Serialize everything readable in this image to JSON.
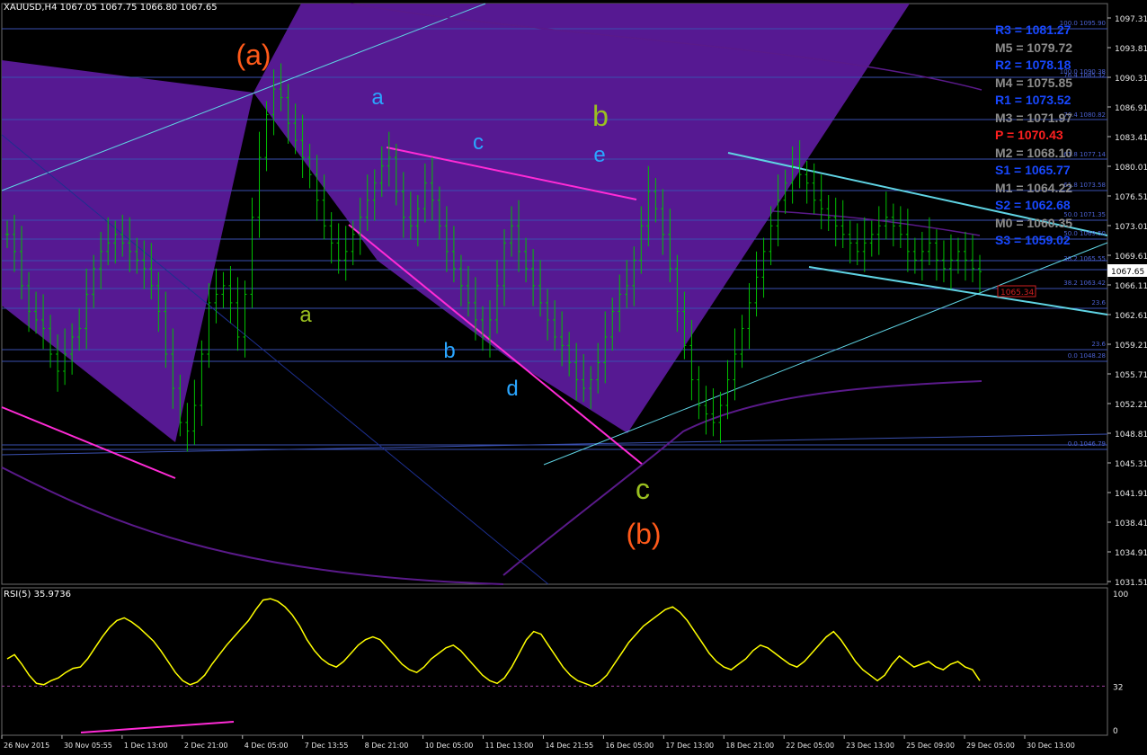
{
  "header": {
    "symbol": "XAUUSD,H4",
    "ohlc": "1067.05 1067.75 1066.80 1067.65",
    "rsi_label": "RSI(5) 35.9736"
  },
  "colors": {
    "background": "#000000",
    "candle": "#00c000",
    "wave_panel": "#5b1a9a",
    "magenta_line": "#ff2bd6",
    "cyan_line": "#5fd3e3",
    "fib_line": "#3a50b0",
    "ma_line": "#5a1a8a",
    "rsi_line": "#ffff00",
    "pivot_blue": "#1848ff",
    "pivot_gray": "#8c8c8c",
    "pivot_red": "#ff2020",
    "wave_orange": "#ff5a1a",
    "wave_green": "#9ac020",
    "wave_blue": "#2aa6ff"
  },
  "pivots": [
    {
      "label": "R3 = 1081.27",
      "color": "blue"
    },
    {
      "label": "M5 = 1079.72",
      "color": "gray"
    },
    {
      "label": "R2 = 1078.18",
      "color": "blue"
    },
    {
      "label": "M4 = 1075.85",
      "color": "gray"
    },
    {
      "label": "R1 = 1073.52",
      "color": "blue"
    },
    {
      "label": "M3 = 1071.97",
      "color": "gray"
    },
    {
      "label": "P  = 1070.43",
      "color": "red"
    },
    {
      "label": "M2 = 1068.10",
      "color": "gray"
    },
    {
      "label": "S1 = 1065.77",
      "color": "blue"
    },
    {
      "label": "M1 = 1064.22",
      "color": "gray"
    },
    {
      "label": "S2 = 1062.68",
      "color": "blue"
    },
    {
      "label": "M0 = 1060.35",
      "color": "gray"
    },
    {
      "label": "S3 = 1059.02",
      "color": "blue"
    }
  ],
  "wave_labels": [
    {
      "text": "(a)",
      "color": "orange"
    },
    {
      "text": "(b)",
      "color": "orange"
    },
    {
      "text": "a",
      "color": "blue"
    },
    {
      "text": "b",
      "color": "blue"
    },
    {
      "text": "c",
      "color": "blue"
    },
    {
      "text": "d",
      "color": "blue"
    },
    {
      "text": "e",
      "color": "blue"
    },
    {
      "text": "a",
      "color": "green"
    },
    {
      "text": "b",
      "color": "green"
    },
    {
      "text": "c",
      "color": "green"
    }
  ],
  "fib_labels": [
    "100.0 1095.90",
    "100.0 1090.38",
    "76.4 1085.32",
    "76.4 1080.82",
    "61.8 1077.14",
    "61.8 1073.58",
    "50.0 1071.35",
    "50.0 1069.50",
    "38.2 1065.55",
    "38.2 1063.42",
    "23.6",
    "23.6",
    "0.0 1048.28",
    "0.0 1046.79"
  ],
  "price_marker": "1065.34",
  "chart_data": {
    "type": "candlestick",
    "timeframe": "H4",
    "price_axis": {
      "ticks": [
        "1097.31",
        "1093.81",
        "1090.31",
        "1086.91",
        "1083.41",
        "1080.01",
        "1076.51",
        "1073.01",
        "1069.61",
        "1066.11",
        "1062.61",
        "1059.21",
        "1055.71",
        "1052.21",
        "1048.81",
        "1045.31",
        "1041.91",
        "1038.41",
        "1034.91",
        "1031.51"
      ],
      "ylim": [
        1031.51,
        1097.31
      ],
      "current": "1067.65"
    },
    "rsi_axis": {
      "ticks": [
        "100",
        "32",
        "0"
      ],
      "level": 32
    },
    "time_ticks": [
      "26 Nov 2015",
      "30 Nov 05:55",
      "1 Dec 13:00",
      "2 Dec 21:00",
      "4 Dec 05:00",
      "7 Dec 13:55",
      "8 Dec 21:00",
      "10 Dec 05:00",
      "11 Dec 13:00",
      "14 Dec 21:55",
      "16 Dec 05:00",
      "17 Dec 13:00",
      "18 Dec 21:00",
      "22 Dec 05:00",
      "23 Dec 13:00",
      "25 Dec 09:00",
      "29 Dec 05:00",
      "30 Dec 13:00"
    ],
    "close_path": [
      1072,
      1070,
      1066,
      1063,
      1062,
      1061,
      1058,
      1056,
      1058,
      1060,
      1061,
      1065,
      1068,
      1070,
      1071,
      1072,
      1071,
      1070,
      1069,
      1068,
      1066,
      1063,
      1058,
      1054,
      1050,
      1049,
      1052,
      1058,
      1064,
      1065,
      1066,
      1064,
      1060,
      1065,
      1074,
      1081,
      1086,
      1089,
      1088,
      1085,
      1083,
      1081,
      1079,
      1076,
      1073,
      1071,
      1069,
      1070,
      1072,
      1074,
      1076,
      1078,
      1080,
      1081,
      1077,
      1074,
      1073,
      1075,
      1078,
      1076,
      1073,
      1070,
      1068,
      1066,
      1064,
      1062,
      1060,
      1062,
      1066,
      1071,
      1073,
      1070,
      1068,
      1066,
      1064,
      1062,
      1060,
      1059,
      1057,
      1055,
      1054,
      1055,
      1057,
      1060,
      1063,
      1065,
      1066,
      1069,
      1073,
      1077,
      1075,
      1072,
      1068,
      1063,
      1059,
      1055,
      1052,
      1051,
      1050,
      1052,
      1055,
      1058,
      1061,
      1064,
      1067,
      1070,
      1073,
      1076,
      1078,
      1080,
      1079,
      1078,
      1076,
      1075,
      1074,
      1073,
      1072,
      1071,
      1070,
      1071,
      1072,
      1073,
      1074,
      1073,
      1072,
      1070,
      1069,
      1070,
      1071,
      1069,
      1068,
      1069,
      1070,
      1069,
      1068,
      1067.65
    ],
    "rsi_values": [
      52,
      55,
      48,
      40,
      34,
      33,
      36,
      38,
      42,
      45,
      46,
      52,
      60,
      68,
      75,
      80,
      82,
      79,
      75,
      70,
      65,
      58,
      50,
      42,
      36,
      33,
      35,
      40,
      48,
      55,
      62,
      68,
      74,
      80,
      88,
      95,
      96,
      94,
      90,
      84,
      76,
      66,
      58,
      52,
      48,
      46,
      50,
      56,
      62,
      66,
      68,
      66,
      60,
      54,
      48,
      44,
      42,
      46,
      52,
      56,
      60,
      62,
      58,
      52,
      46,
      40,
      36,
      34,
      38,
      46,
      56,
      66,
      72,
      70,
      62,
      54,
      46,
      40,
      36,
      34,
      32,
      35,
      40,
      48,
      56,
      64,
      70,
      76,
      80,
      84,
      88,
      90,
      86,
      80,
      72,
      64,
      56,
      50,
      46,
      44,
      48,
      52,
      58,
      62,
      60,
      56,
      52,
      48,
      46,
      50,
      56,
      62,
      68,
      72,
      66,
      58,
      50,
      44,
      40,
      36,
      40,
      48,
      54,
      50,
      46,
      48,
      50,
      46,
      44,
      48,
      50,
      46,
      44,
      36
    ]
  }
}
